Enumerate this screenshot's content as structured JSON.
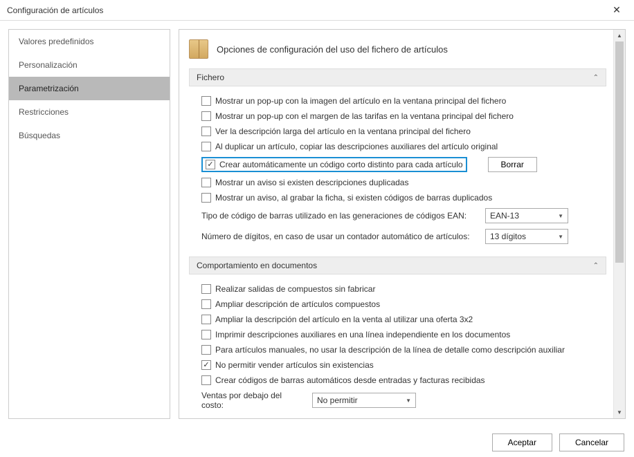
{
  "window": {
    "title": "Configuración de artículos",
    "close": "✕"
  },
  "sidebar": {
    "items": [
      {
        "label": "Valores predefinidos"
      },
      {
        "label": "Personalización"
      },
      {
        "label": "Parametrización"
      },
      {
        "label": "Restricciones"
      },
      {
        "label": "Búsquedas"
      }
    ]
  },
  "header": {
    "title": "Opciones de configuración del uso del fichero de artículos"
  },
  "sections": {
    "fichero": {
      "title": "Fichero",
      "checks": [
        "Mostrar un pop-up con la imagen del artículo en la ventana principal del fichero",
        "Mostrar un pop-up con el margen de las tarifas en la ventana principal del fichero",
        "Ver la descripción larga del artículo en la ventana principal del fichero",
        "Al duplicar un artículo, copiar las descripciones auxiliares del artículo original",
        "Crear automáticamente un código corto distinto para cada artículo",
        "Mostrar un aviso si existen descripciones duplicadas",
        "Mostrar un aviso, al grabar la ficha, si existen códigos de barras duplicados"
      ],
      "borrar": "Borrar",
      "barcode_label": "Tipo de código de barras utilizado en las generaciones de códigos EAN:",
      "barcode_value": "EAN-13",
      "digits_label": "Número de dígitos, en caso de usar un contador automático de artículos:",
      "digits_value": "13 dígitos"
    },
    "comportamiento": {
      "title": "Comportamiento en documentos",
      "checks": [
        "Realizar salidas de compuestos sin fabricar",
        "Ampliar descripción de artículos compuestos",
        "Ampliar la descripción del artículo en la venta al utilizar una oferta 3x2",
        "Imprimir descripciones auxiliares en una línea independiente en los documentos",
        "Para artículos manuales, no usar la descripción de la línea de detalle como descripción auxiliar",
        "No permitir vender artículos sin existencias",
        "Crear códigos de barras automáticos desde entradas y facturas recibidas"
      ],
      "cost_label": "Ventas por debajo del costo:",
      "cost_value": "No permitir"
    }
  },
  "footer": {
    "ok": "Aceptar",
    "cancel": "Cancelar"
  }
}
